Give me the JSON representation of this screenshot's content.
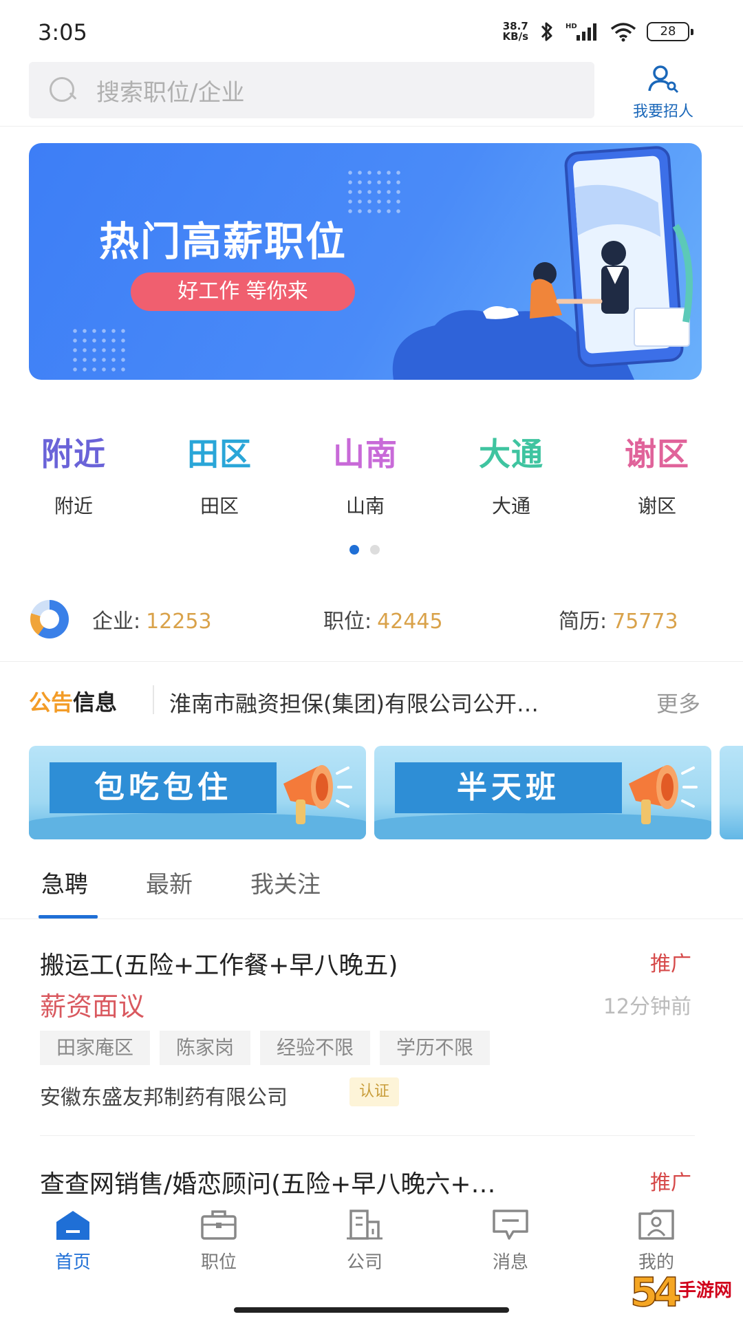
{
  "status_bar": {
    "time": "3:05",
    "net_speed_value": "38.7",
    "net_speed_unit": "KB/s",
    "battery": "28",
    "icons": [
      "bluetooth-icon",
      "signal-icon",
      "wifi-icon",
      "battery-icon"
    ]
  },
  "search": {
    "placeholder": "搜索职位/企业",
    "recruit_label": "我要招人"
  },
  "banner": {
    "title": "热门高薪职位",
    "subtitle": "好工作 等你来"
  },
  "quick_nav": {
    "items": [
      {
        "logo": "附近",
        "label": "附近",
        "color": "#6a63d8"
      },
      {
        "logo": "田区",
        "label": "田区",
        "color": "#2aa6d8"
      },
      {
        "logo": "山南",
        "label": "山南",
        "color": "#c86ad8"
      },
      {
        "logo": "大通",
        "label": "大通",
        "color": "#3fc4a0"
      },
      {
        "logo": "谢区",
        "label": "谢区",
        "color": "#e0639a"
      }
    ],
    "page_index": 1,
    "page_count": 2
  },
  "stats": {
    "company_label": "企业:",
    "company_value": "12253",
    "job_label": "职位:",
    "job_value": "42445",
    "resume_label": "简历:",
    "resume_value": "75773"
  },
  "notice": {
    "tag_part1": "公告",
    "tag_part2": "信息",
    "text": "淮南市融资担保(集团)有限公司公开…",
    "more": "更多"
  },
  "promos": [
    {
      "label": "包吃包住"
    },
    {
      "label": "半天班"
    }
  ],
  "tabs": [
    {
      "label": "急聘",
      "active": true
    },
    {
      "label": "最新",
      "active": false
    },
    {
      "label": "我关注",
      "active": false
    }
  ],
  "jobs": [
    {
      "title": "搬运工(五险+工作餐+早八晚五)",
      "promo": "推广",
      "salary": "薪资面议",
      "time": "12分钟前",
      "tags": [
        "田家庵区",
        "陈家岗",
        "经验不限",
        "学历不限"
      ],
      "company": "安徽东盛友邦制药有限公司",
      "cert": "认证"
    },
    {
      "title": "查查网销售/婚恋顾问(五险+早八晚六+…",
      "promo": "推广"
    }
  ],
  "bottom_nav": [
    {
      "label": "首页",
      "icon": "home-icon",
      "active": true
    },
    {
      "label": "职位",
      "icon": "briefcase-icon",
      "active": false
    },
    {
      "label": "公司",
      "icon": "building-icon",
      "active": false
    },
    {
      "label": "消息",
      "icon": "message-icon",
      "active": false
    },
    {
      "label": "我的",
      "icon": "profile-icon",
      "active": false
    }
  ],
  "watermark": {
    "text": "手游网"
  },
  "colors": {
    "primary": "#1f6fd6",
    "salary": "#d9595f",
    "stat_number": "#d9a24a",
    "notice_tag": "#f39c27"
  }
}
